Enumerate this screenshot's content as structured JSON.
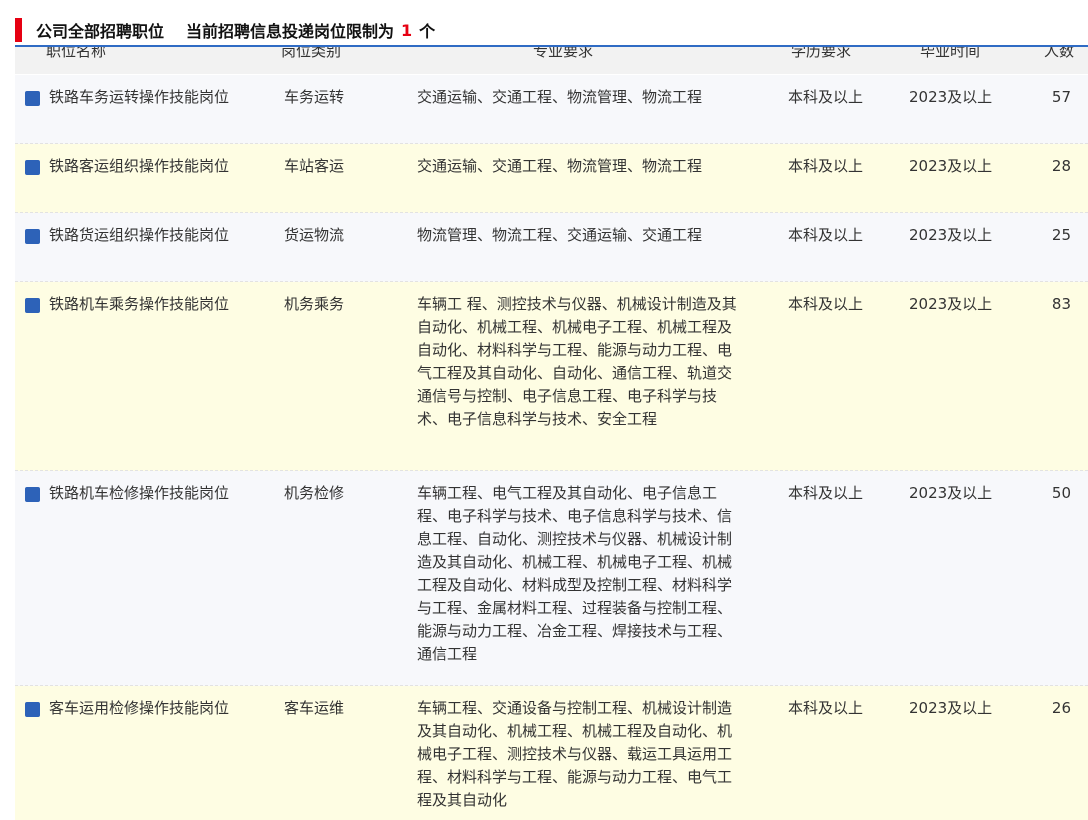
{
  "header": {
    "title": "公司全部招聘职位",
    "limit_text": "当前招聘信息投递岗位限制为",
    "limit_count": "1",
    "limit_unit": "个"
  },
  "columns": {
    "name": "职位名称",
    "category": "岗位类别",
    "major": "专业要求",
    "education": "学历要求",
    "graduation": "毕业时间",
    "count": "人数"
  },
  "rows": [
    {
      "name": "铁路车务运转操作技能岗位",
      "category": "车务运转",
      "major": "交通运输、交通工程、物流管理、物流工程",
      "education": "本科及以上",
      "graduation": "2023及以上",
      "count": "57"
    },
    {
      "name": "铁路客运组织操作技能岗位",
      "category": "车站客运",
      "major": "交通运输、交通工程、物流管理、物流工程",
      "education": "本科及以上",
      "graduation": "2023及以上",
      "count": "28"
    },
    {
      "name": "铁路货运组织操作技能岗位",
      "category": "货运物流",
      "major": "物流管理、物流工程、交通运输、交通工程",
      "education": "本科及以上",
      "graduation": "2023及以上",
      "count": "25"
    },
    {
      "name": "铁路机车乘务操作技能岗位",
      "category": "机务乘务",
      "major": "车辆工 程、测控技术与仪器、机械设计制造及其自动化、机械工程、机械电子工程、机械工程及自动化、材料科学与工程、能源与动力工程、电气工程及其自动化、自动化、通信工程、轨道交通信号与控制、电子信息工程、电子科学与技术、电子信息科学与技术、安全工程",
      "education": "本科及以上",
      "graduation": "2023及以上",
      "count": "83"
    },
    {
      "name": "铁路机车检修操作技能岗位",
      "category": "机务检修",
      "major": "车辆工程、电气工程及其自动化、电子信息工程、电子科学与技术、电子信息科学与技术、信息工程、自动化、测控技术与仪器、机械设计制造及其自动化、机械工程、机械电子工程、机械工程及自动化、材料成型及控制工程、材料科学与工程、金属材料工程、过程装备与控制工程、能源与动力工程、冶金工程、焊接技术与工程、通信工程",
      "education": "本科及以上",
      "graduation": "2023及以上",
      "count": "50"
    },
    {
      "name": "客车运用检修操作技能岗位",
      "category": "客车运维",
      "major": "车辆工程、交通设备与控制工程、机械设计制造及其自动化、机械工程、机械工程及自动化、机械电子工程、测控技术与仪器、载运工具运用工程、材料科学与工程、能源与动力工程、电气工程及其自动化",
      "education": "本科及以上",
      "graduation": "2023及以上",
      "count": "26"
    }
  ]
}
